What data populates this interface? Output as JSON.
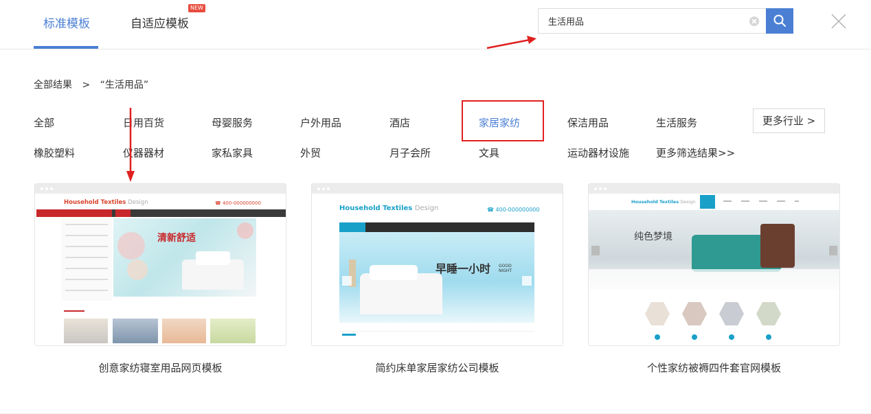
{
  "tabs": [
    {
      "label": "标准模板",
      "active": true
    },
    {
      "label": "自适应模板",
      "badge": "NEW"
    }
  ],
  "search": {
    "value": "生活用品"
  },
  "breadcrumb": {
    "root": "全部结果",
    "separator": ">",
    "current": "“生活用品”"
  },
  "categories": {
    "row1": [
      "全部",
      "日用百货",
      "母婴服务",
      "户外用品",
      "酒店",
      "家居家纺",
      "保洁用品",
      "生活服务"
    ],
    "row2": [
      "橡胶塑料",
      "仪器器材",
      "家私家具",
      "外贸",
      "月子会所",
      "文具",
      "运动器材设施",
      "更多筛选结果>>"
    ],
    "active": "家居家纺",
    "more_button": "更多行业 >"
  },
  "templates": [
    {
      "title": "创意家纺寝室用品网页模板",
      "preview": {
        "logo": "Household Textiles",
        "logo_sub": "Design",
        "phone": "400-000000000",
        "banner_text": "清新舒适"
      }
    },
    {
      "title": "简约床单家居家纺公司模板",
      "preview": {
        "logo": "Household Textiles",
        "logo_sub": "Design",
        "phone": "400-000000000",
        "banner_text": "早睡一小时",
        "banner_sub": "GOOD NIGHT"
      }
    },
    {
      "title": "个性家纺被褥四件套官网模板",
      "preview": {
        "logo": "Household Textiles",
        "logo_sub": "Design",
        "banner_text": "纯色梦境"
      }
    }
  ],
  "colors": {
    "accent": "#4a7fd4",
    "highlight": "#e02020",
    "badge": "#e84c3d"
  }
}
